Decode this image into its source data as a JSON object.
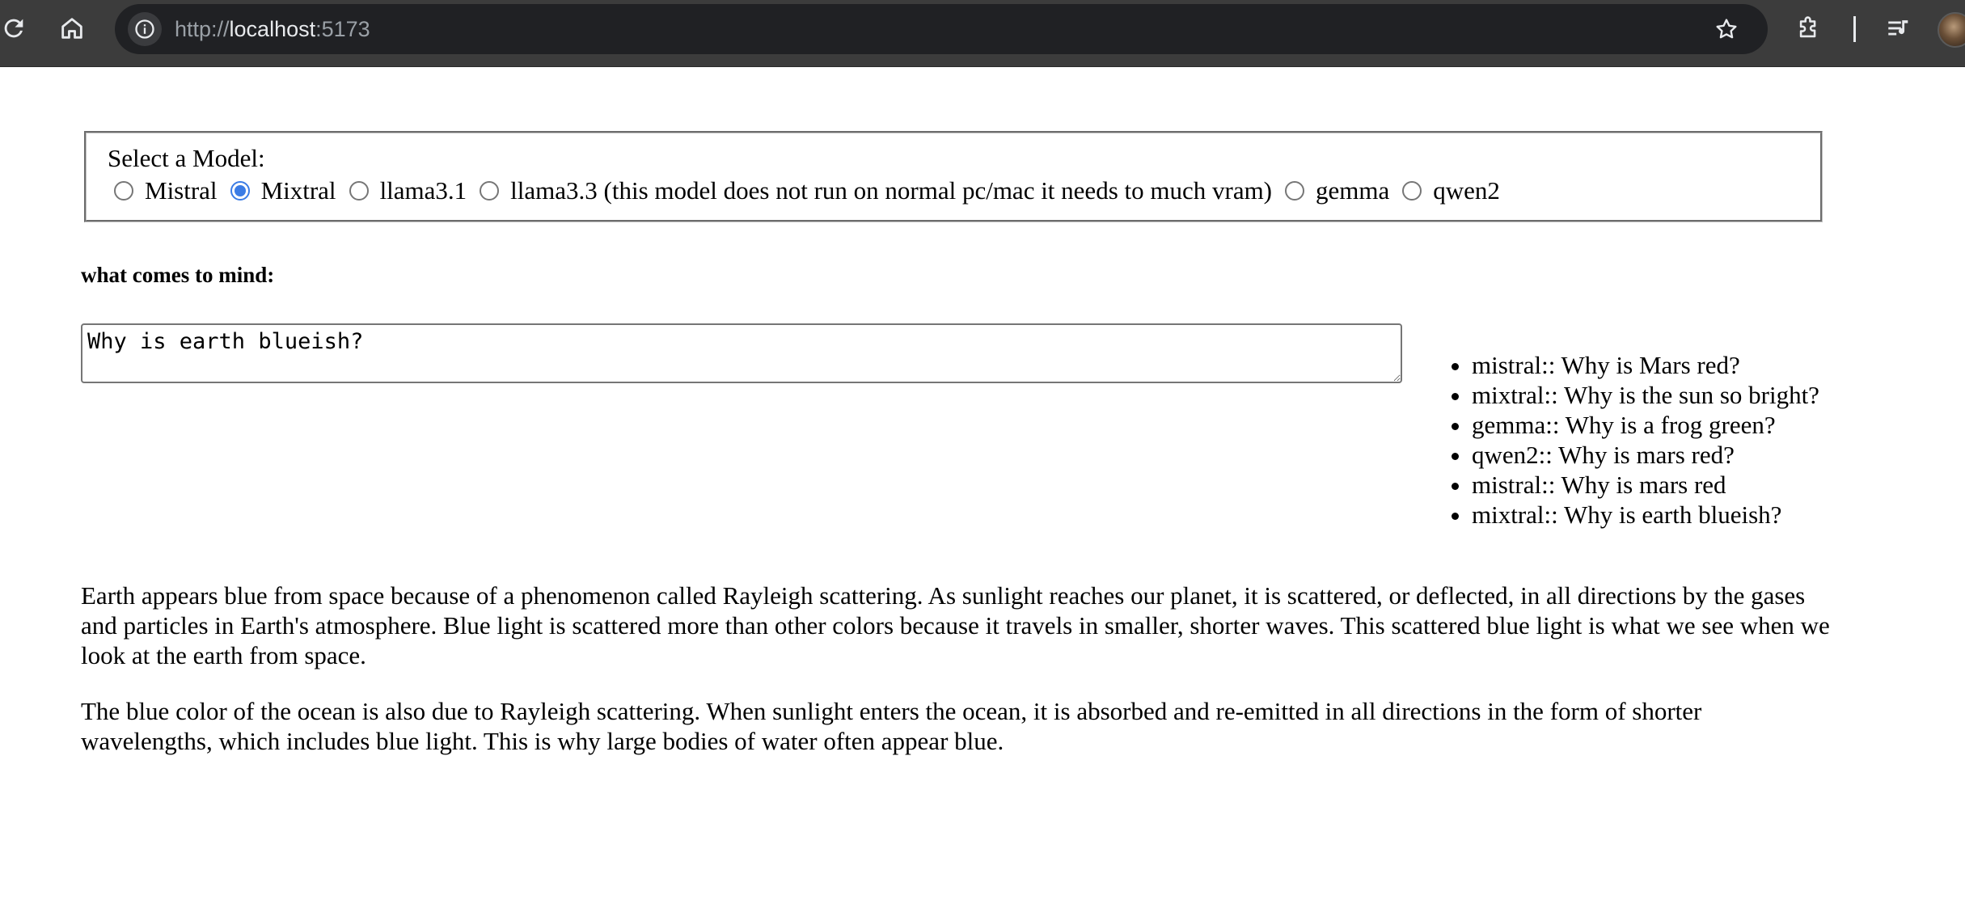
{
  "browser": {
    "url": {
      "scheme": "http://",
      "host": "localhost",
      "port": ":5173"
    },
    "icons": {
      "reload": "reload-icon",
      "home": "home-icon",
      "site_info": "info-icon",
      "bookmark": "star-icon",
      "extensions": "puzzle-icon",
      "media": "media-controls-icon",
      "profile": "avatar"
    },
    "colors": {
      "toolbar_bg": "#3c3c3c",
      "omnibox_bg": "#202124",
      "url_dim": "#9aa0a6",
      "url_host": "#e8eaed",
      "radio_accent": "#3b7ce5"
    }
  },
  "model_select": {
    "legend": "Select a Model:",
    "options": [
      {
        "label": "Mistral",
        "checked": false
      },
      {
        "label": "Mixtral",
        "checked": true
      },
      {
        "label": "llama3.1",
        "checked": false
      },
      {
        "label": "llama3.3 (this model does not run on normal pc/mac it needs to much vram)",
        "checked": false
      },
      {
        "label": "gemma",
        "checked": false
      },
      {
        "label": "qwen2",
        "checked": false
      }
    ]
  },
  "prompt": {
    "label": "what comes to mind:",
    "value": "Why is earth blueish?"
  },
  "history": [
    "mistral:: Why is Mars red?",
    "mixtral:: Why is the sun so bright?",
    "gemma:: Why is a frog green?",
    "qwen2:: Why is mars red?",
    "mistral:: Why is mars red",
    "mixtral:: Why is earth blueish?"
  ],
  "answer": {
    "paragraphs": [
      "Earth appears blue from space because of a phenomenon called Rayleigh scattering. As sunlight reaches our planet, it is scattered, or deflected, in all directions by the gases and particles in Earth's atmosphere. Blue light is scattered more than other colors because it travels in smaller, shorter waves. This scattered blue light is what we see when we look at the earth from space.",
      "The blue color of the ocean is also due to Rayleigh scattering. When sunlight enters the ocean, it is absorbed and re-emitted in all directions in the form of shorter wavelengths, which includes blue light. This is why large bodies of water often appear blue."
    ]
  }
}
